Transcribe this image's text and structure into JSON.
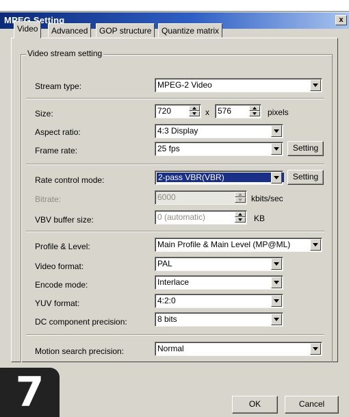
{
  "window": {
    "title": "MPEG Setting",
    "close_symbol": "x"
  },
  "tabs": [
    {
      "label": "Video",
      "active": true
    },
    {
      "label": "Advanced",
      "active": false
    },
    {
      "label": "GOP structure",
      "active": false
    },
    {
      "label": "Quantize matrix",
      "active": false
    }
  ],
  "group": {
    "title": "Video stream setting"
  },
  "fields": {
    "stream_type": {
      "label": "Stream type:",
      "value": "MPEG-2 Video"
    },
    "size": {
      "label": "Size:",
      "width": "720",
      "times": "x",
      "height": "576",
      "unit": "pixels"
    },
    "aspect_ratio": {
      "label": "Aspect ratio:",
      "value": "4:3 Display"
    },
    "frame_rate": {
      "label": "Frame rate:",
      "value": "25 fps",
      "button": "Setting"
    },
    "rate_control_mode": {
      "label": "Rate control mode:",
      "value": "2-pass VBR(VBR)",
      "button": "Setting"
    },
    "bitrate": {
      "label": "Bitrate:",
      "value": "6000",
      "unit": "kbits/sec"
    },
    "vbv_buffer_size": {
      "label": "VBV buffer size:",
      "value": "0 (automatic)",
      "unit": "KB"
    },
    "profile_level": {
      "label": "Profile & Level:",
      "value": "Main Profile & Main Level (MP@ML)"
    },
    "video_format": {
      "label": "Video format:",
      "value": "PAL"
    },
    "encode_mode": {
      "label": "Encode mode:",
      "value": "Interlace"
    },
    "yuv_format": {
      "label": "YUV format:",
      "value": "4:2:0"
    },
    "dc_precision": {
      "label": "DC component precision:",
      "value": "8 bits"
    },
    "motion_search": {
      "label": "Motion search precision:",
      "value": "Normal"
    }
  },
  "buttons": {
    "ok": "OK",
    "cancel": "Cancel"
  },
  "badge": {
    "number": "7"
  },
  "colors": {
    "title_start": "#0b2a7a",
    "title_end": "#a7c3ee",
    "selection": "#1a2f86",
    "dialog_bg": "#d8d5cd"
  }
}
